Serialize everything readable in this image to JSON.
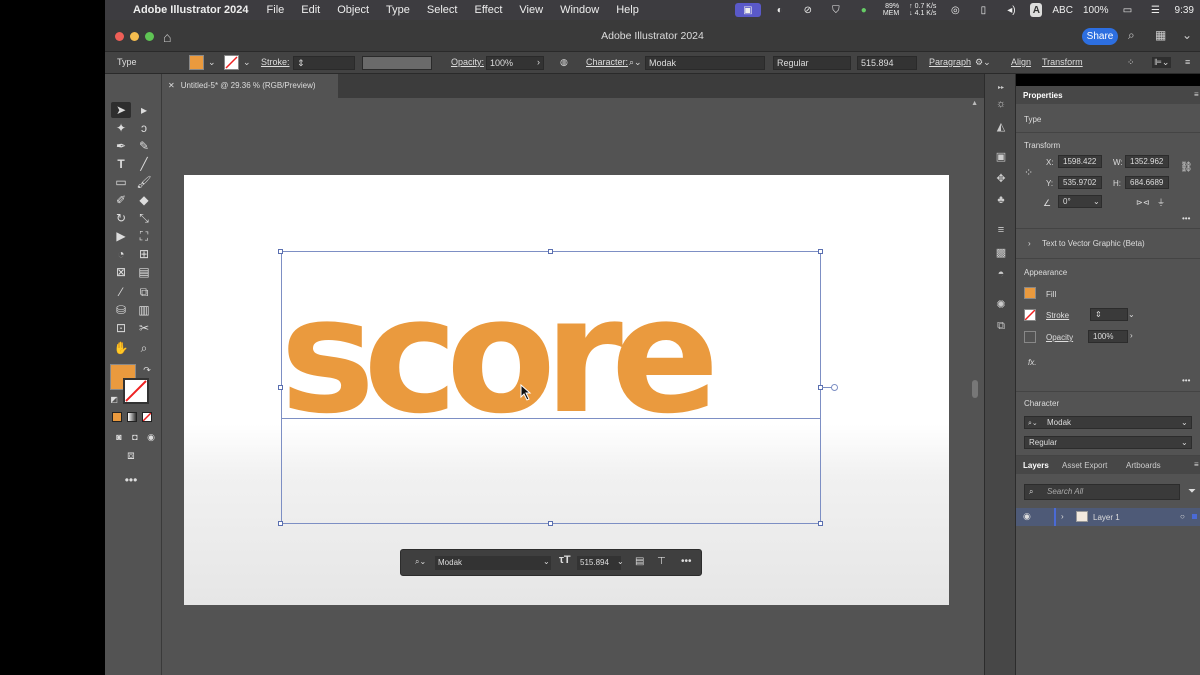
{
  "menubar": {
    "app_name": "Adobe Illustrator 2024",
    "items": [
      "File",
      "Edit",
      "Object",
      "Type",
      "Select",
      "Effect",
      "View",
      "Window",
      "Help"
    ],
    "battery_small": "89%",
    "mem_label": "MEM",
    "net_up": "↑ 0.7 K/s",
    "net_down": "↓ 4.1 K/s",
    "input_source": "A",
    "input_label": "ABC",
    "battery": "100%",
    "clock": "9:39"
  },
  "titlebar": {
    "title": "Adobe Illustrator 2024",
    "share_label": "Share"
  },
  "controlbar": {
    "type_label": "Type",
    "stroke_label": "Stroke:",
    "opacity_label": "Opacity:",
    "opacity_value": "100%",
    "character_label": "Character:",
    "font_name": "Modak",
    "font_style": "Regular",
    "font_size": "515.894",
    "paragraph_label": "Paragraph",
    "align_label": "Align",
    "transform_label": "Transform",
    "fill_color": "#ea9a3e"
  },
  "document": {
    "tab_title": "Untitled-5* @ 29.36 % (RGB/Preview)",
    "artboard_text": "score",
    "text_color": "#ea9a3e"
  },
  "context_bar": {
    "font_name": "Modak",
    "font_size": "515.894"
  },
  "properties": {
    "tabs": [
      "Properties"
    ],
    "type_label": "Type",
    "transform_header": "Transform",
    "x_label": "X:",
    "x_value": "1598.422",
    "y_label": "Y:",
    "y_value": "535.9702",
    "w_label": "W:",
    "w_value": "1352.962",
    "h_label": "H:",
    "h_value": "684.6689",
    "rotation_value": "0°",
    "text_to_vector": "Text to Vector Graphic (Beta)",
    "appearance_header": "Appearance",
    "fill_label": "Fill",
    "stroke_label": "Stroke",
    "opacity_label": "Opacity",
    "opacity_value": "100%",
    "fx_label": "fx.",
    "character_header": "Character",
    "font_name": "Modak",
    "font_style": "Regular"
  },
  "layers": {
    "tabs": [
      "Layers",
      "Asset Export",
      "Artboards"
    ],
    "search_placeholder": "Search All",
    "layer_name": "Layer 1"
  }
}
